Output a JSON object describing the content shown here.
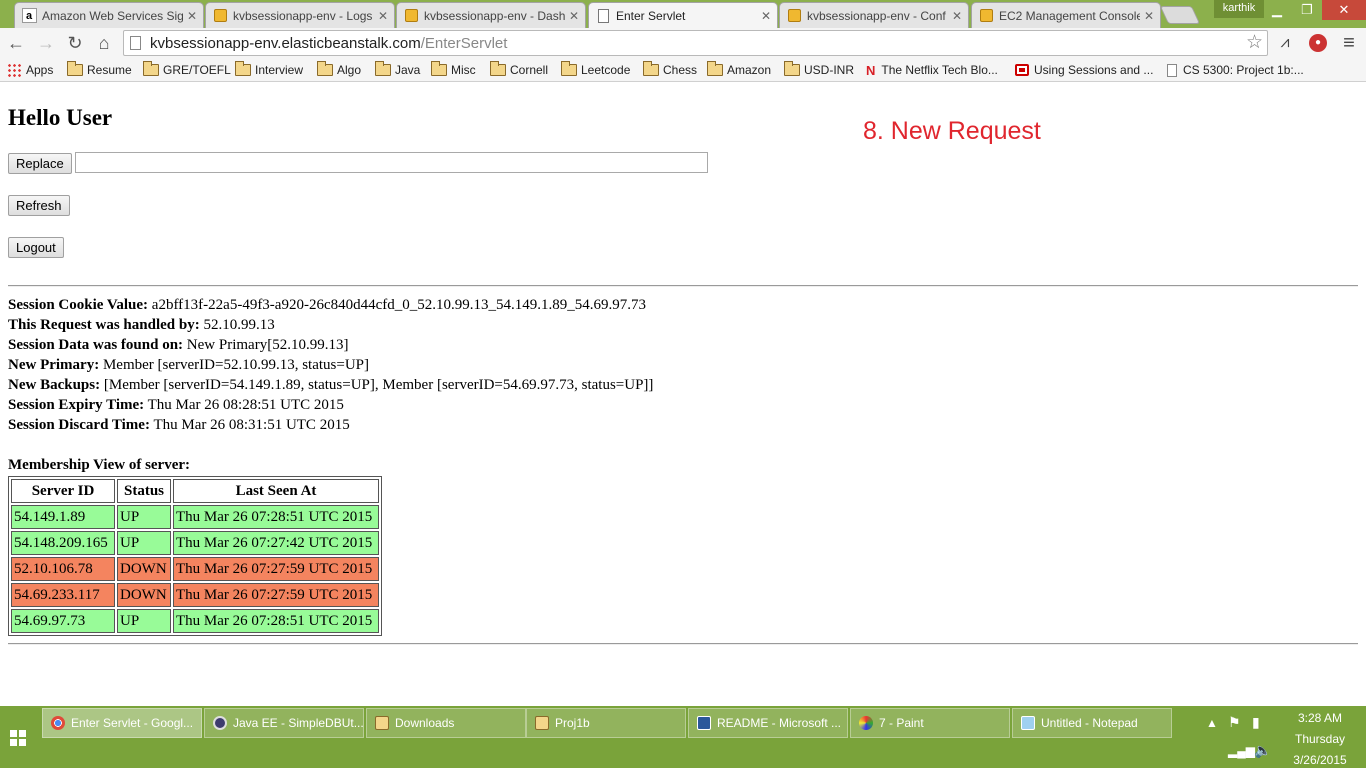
{
  "browser": {
    "tabs": [
      {
        "title": "Amazon Web Services Sig",
        "icon": "amazon-icon"
      },
      {
        "title": "kvbsessionapp-env - Logs",
        "icon": "aws-cube-icon"
      },
      {
        "title": "kvbsessionapp-env - Dash",
        "icon": "aws-cube-icon"
      },
      {
        "title": "Enter Servlet",
        "icon": "page-icon",
        "active": true
      },
      {
        "title": "kvbsessionapp-env - Conf",
        "icon": "aws-cube-icon"
      },
      {
        "title": "EC2 Management Console",
        "icon": "aws-cube-icon"
      }
    ],
    "user": "karthik",
    "url_host": "kvbsessionapp-env.elasticbeanstalk.com",
    "url_path": "/EnterServlet",
    "bookmarks": [
      {
        "label": "Apps",
        "icon": "apps-grid-icon"
      },
      {
        "label": "Resume",
        "icon": "folder-icon"
      },
      {
        "label": "GRE/TOEFL",
        "icon": "folder-icon"
      },
      {
        "label": "Interview",
        "icon": "folder-icon"
      },
      {
        "label": "Algo",
        "icon": "folder-icon"
      },
      {
        "label": "Java",
        "icon": "folder-icon"
      },
      {
        "label": "Misc",
        "icon": "folder-icon"
      },
      {
        "label": "Cornell",
        "icon": "folder-icon"
      },
      {
        "label": "Leetcode",
        "icon": "folder-icon"
      },
      {
        "label": "Chess",
        "icon": "folder-icon"
      },
      {
        "label": "Amazon",
        "icon": "folder-icon"
      },
      {
        "label": "USD-INR",
        "icon": "folder-icon"
      },
      {
        "label": "The Netflix Tech Blo...",
        "icon": "netflix-icon"
      },
      {
        "label": "Using Sessions and ...",
        "icon": "oracle-icon"
      },
      {
        "label": "CS 5300: Project 1b:...",
        "icon": "page-icon"
      }
    ]
  },
  "page": {
    "greeting": "Hello User",
    "annotation": "8. New Request",
    "replace_button": "Replace",
    "replace_input_value": "",
    "refresh_button": "Refresh",
    "logout_button": "Logout",
    "info": [
      {
        "label": "Session Cookie Value:",
        "value": "a2bff13f-22a5-49f3-a920-26c840d44cfd_0_52.10.99.13_54.149.1.89_54.69.97.73"
      },
      {
        "label": "This Request was handled by:",
        "value": "52.10.99.13"
      },
      {
        "label": "Session Data was found on:",
        "value": "New Primary[52.10.99.13]"
      },
      {
        "label": "New Primary:",
        "value": "Member [serverID=52.10.99.13, status=UP]"
      },
      {
        "label": "New Backups:",
        "value": "[Member [serverID=54.149.1.89, status=UP], Member [serverID=54.69.97.73, status=UP]]"
      },
      {
        "label": "Session Expiry Time:",
        "value": "Thu Mar 26 08:28:51 UTC 2015"
      },
      {
        "label": "Session Discard Time:",
        "value": "Thu Mar 26 08:31:51 UTC 2015"
      }
    ],
    "membership_title": "Membership View of server:",
    "membership_headers": [
      "Server ID",
      "Status",
      "Last Seen At"
    ],
    "membership_rows": [
      {
        "server_id": "54.149.1.89",
        "status": "UP",
        "last_seen": "Thu Mar 26 07:28:51 UTC 2015"
      },
      {
        "server_id": "54.148.209.165",
        "status": "UP",
        "last_seen": "Thu Mar 26 07:27:42 UTC 2015"
      },
      {
        "server_id": "52.10.106.78",
        "status": "DOWN",
        "last_seen": "Thu Mar 26 07:27:59 UTC 2015"
      },
      {
        "server_id": "54.69.233.117",
        "status": "DOWN",
        "last_seen": "Thu Mar 26 07:27:59 UTC 2015"
      },
      {
        "server_id": "54.69.97.73",
        "status": "UP",
        "last_seen": "Thu Mar 26 07:28:51 UTC 2015"
      }
    ],
    "colors": {
      "up": "#98fb98",
      "down": "#f4845f",
      "annotation": "#e0262e"
    }
  },
  "taskbar": {
    "items": [
      {
        "label": "Enter Servlet - Googl...",
        "icon": "chrome-icon",
        "active": true
      },
      {
        "label": "Java EE - SimpleDBUt...",
        "icon": "eclipse-icon"
      },
      {
        "label": "Downloads",
        "icon": "folder-icon"
      },
      {
        "label": "Proj1b",
        "icon": "folder-icon"
      },
      {
        "label": "README - Microsoft ...",
        "icon": "word-icon"
      },
      {
        "label": "7 - Paint",
        "icon": "paint-icon"
      },
      {
        "label": "Untitled - Notepad",
        "icon": "notepad-icon"
      }
    ],
    "time": "3:28 AM",
    "day": "Thursday",
    "date": "3/26/2015"
  }
}
